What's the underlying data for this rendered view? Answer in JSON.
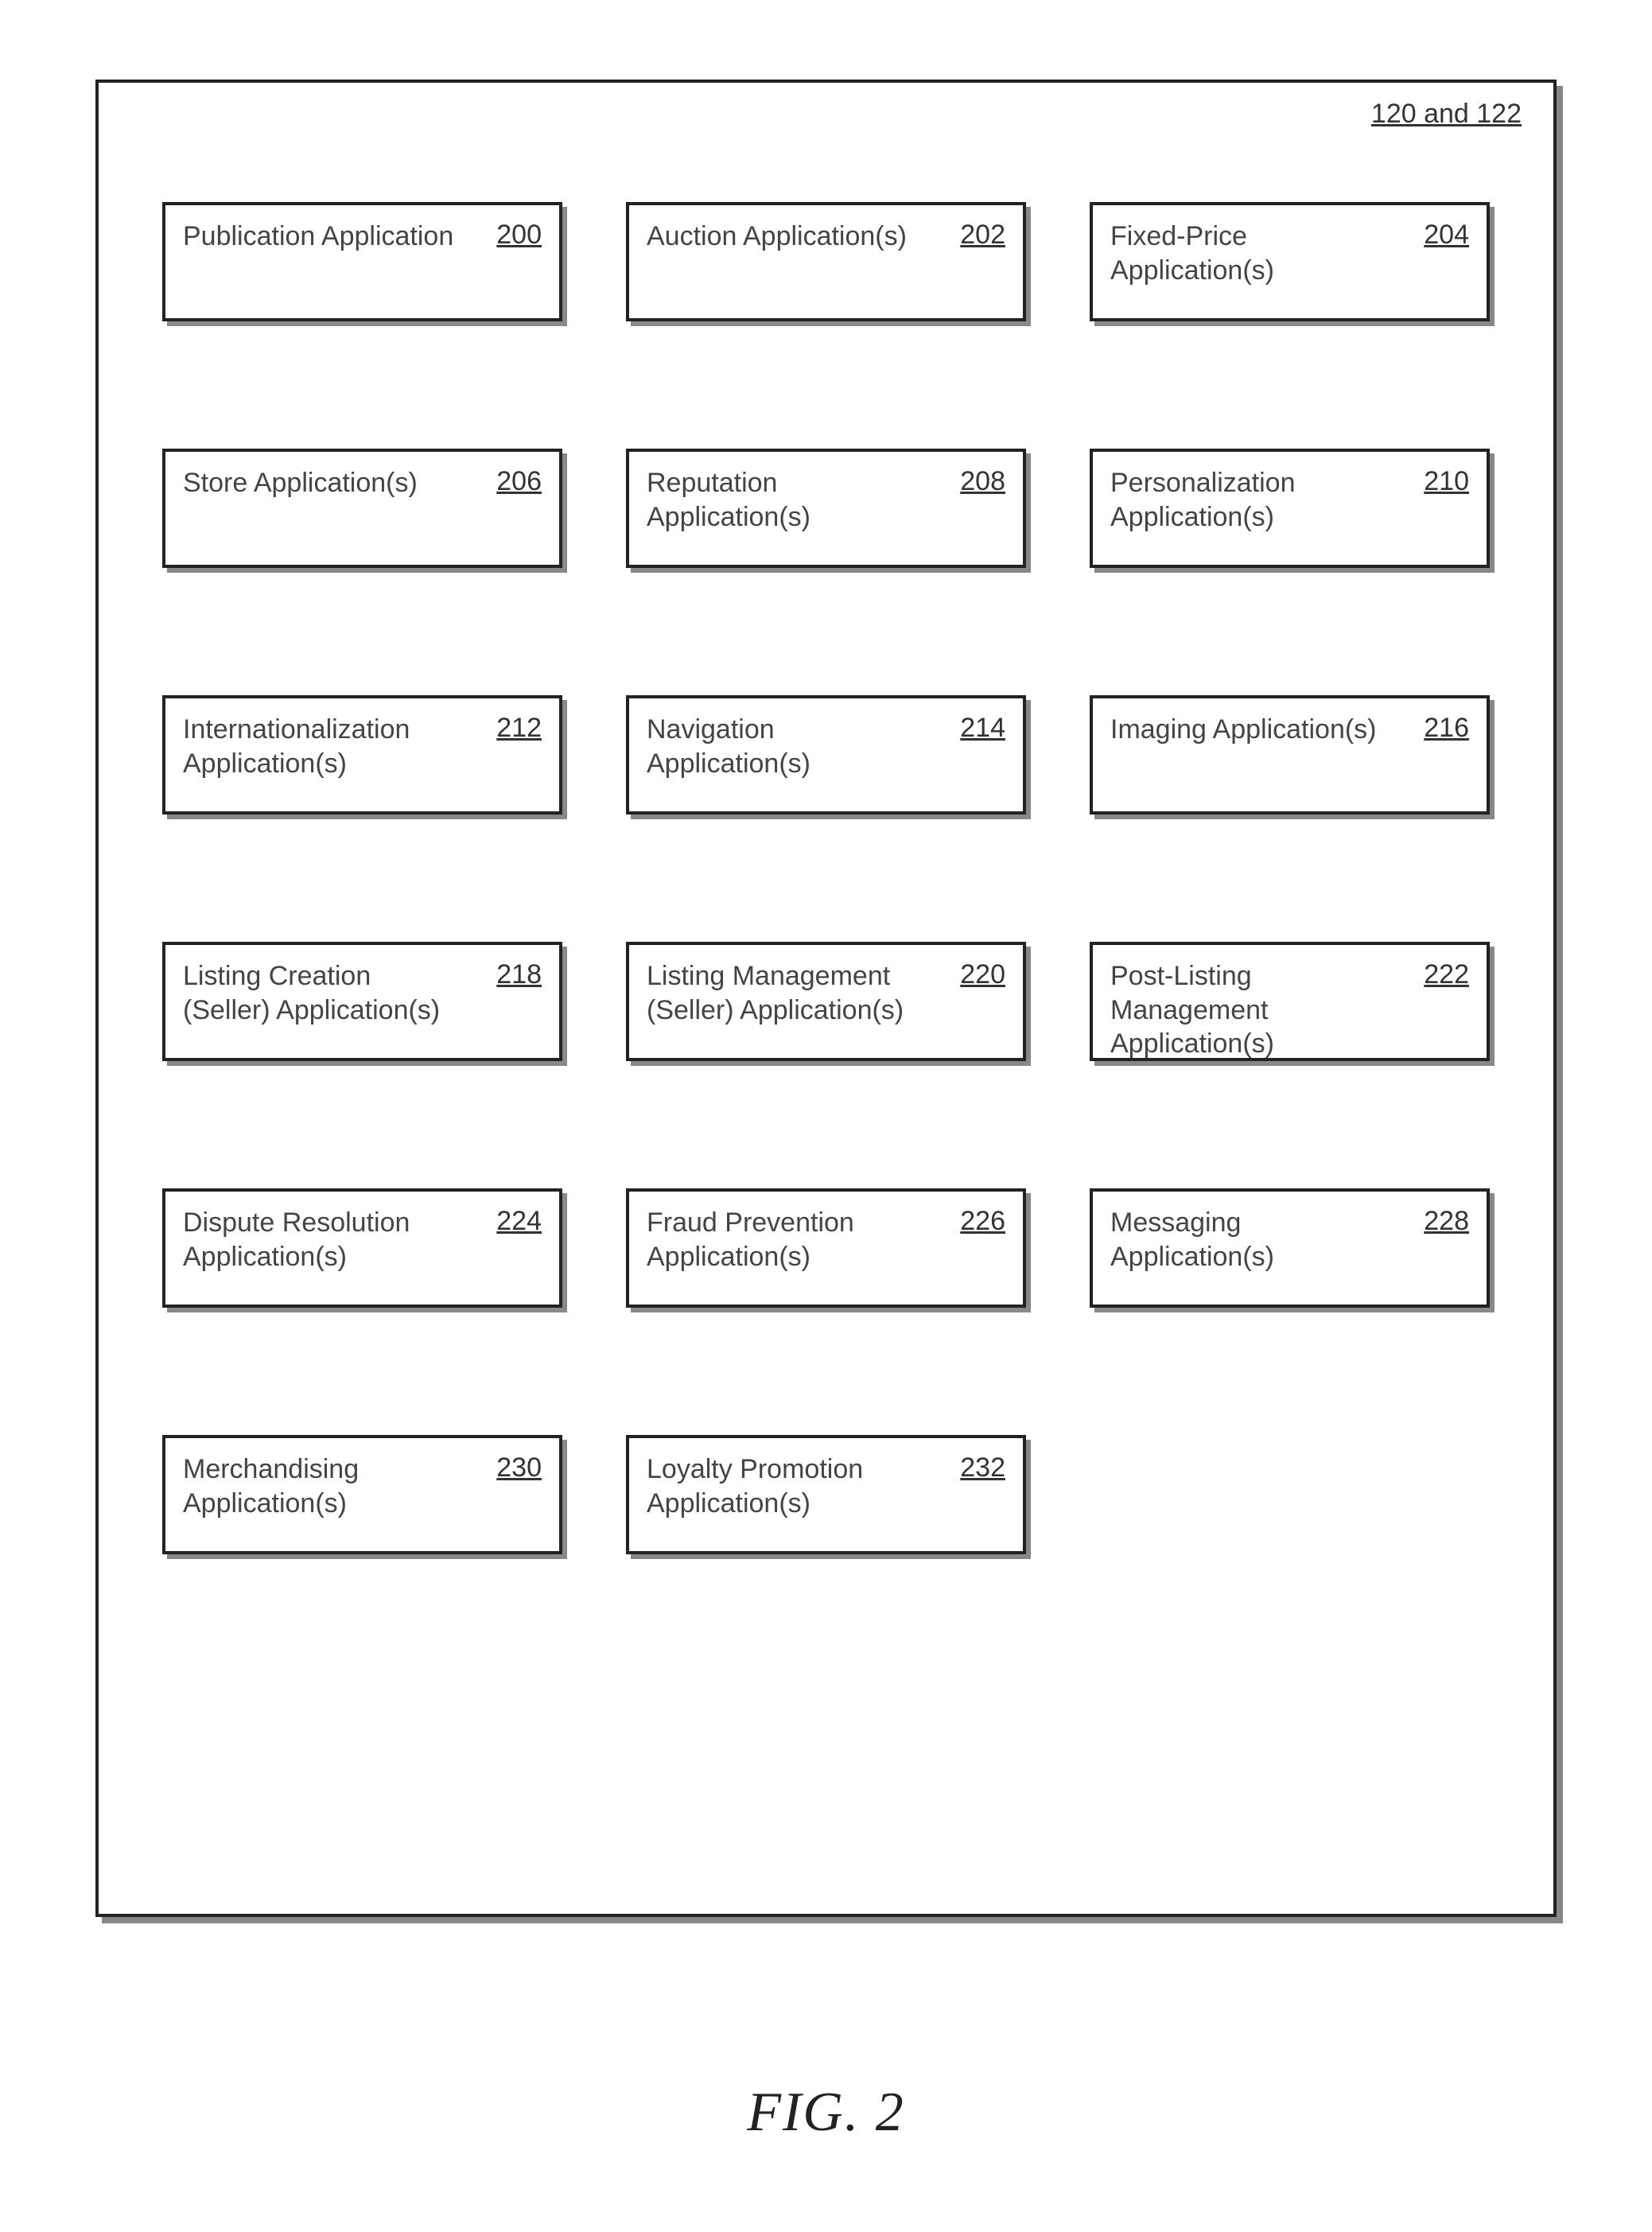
{
  "outer_ref": "120 and 122",
  "caption": "FIG. 2",
  "blocks": [
    {
      "label": "Publication Application",
      "ref": "200"
    },
    {
      "label": "Auction Application(s)",
      "ref": "202"
    },
    {
      "label": "Fixed-Price Application(s)",
      "ref": "204"
    },
    {
      "label": "Store Application(s)",
      "ref": "206"
    },
    {
      "label": "Reputation Application(s)",
      "ref": "208"
    },
    {
      "label": "Personalization Application(s)",
      "ref": "210"
    },
    {
      "label": "Internationalization Application(s)",
      "ref": "212"
    },
    {
      "label": "Navigation Application(s)",
      "ref": "214"
    },
    {
      "label": "Imaging Application(s)",
      "ref": "216"
    },
    {
      "label": "Listing Creation (Seller) Application(s)",
      "ref": "218"
    },
    {
      "label": "Listing Management (Seller) Application(s)",
      "ref": "220"
    },
    {
      "label": "Post-Listing Management Application(s)",
      "ref": "222"
    },
    {
      "label": "Dispute Resolution Application(s)",
      "ref": "224"
    },
    {
      "label": "Fraud Prevention Application(s)",
      "ref": "226"
    },
    {
      "label": "Messaging Application(s)",
      "ref": "228"
    },
    {
      "label": "Merchandising Application(s)",
      "ref": "230"
    },
    {
      "label": "Loyalty Promotion Application(s)",
      "ref": "232"
    }
  ]
}
